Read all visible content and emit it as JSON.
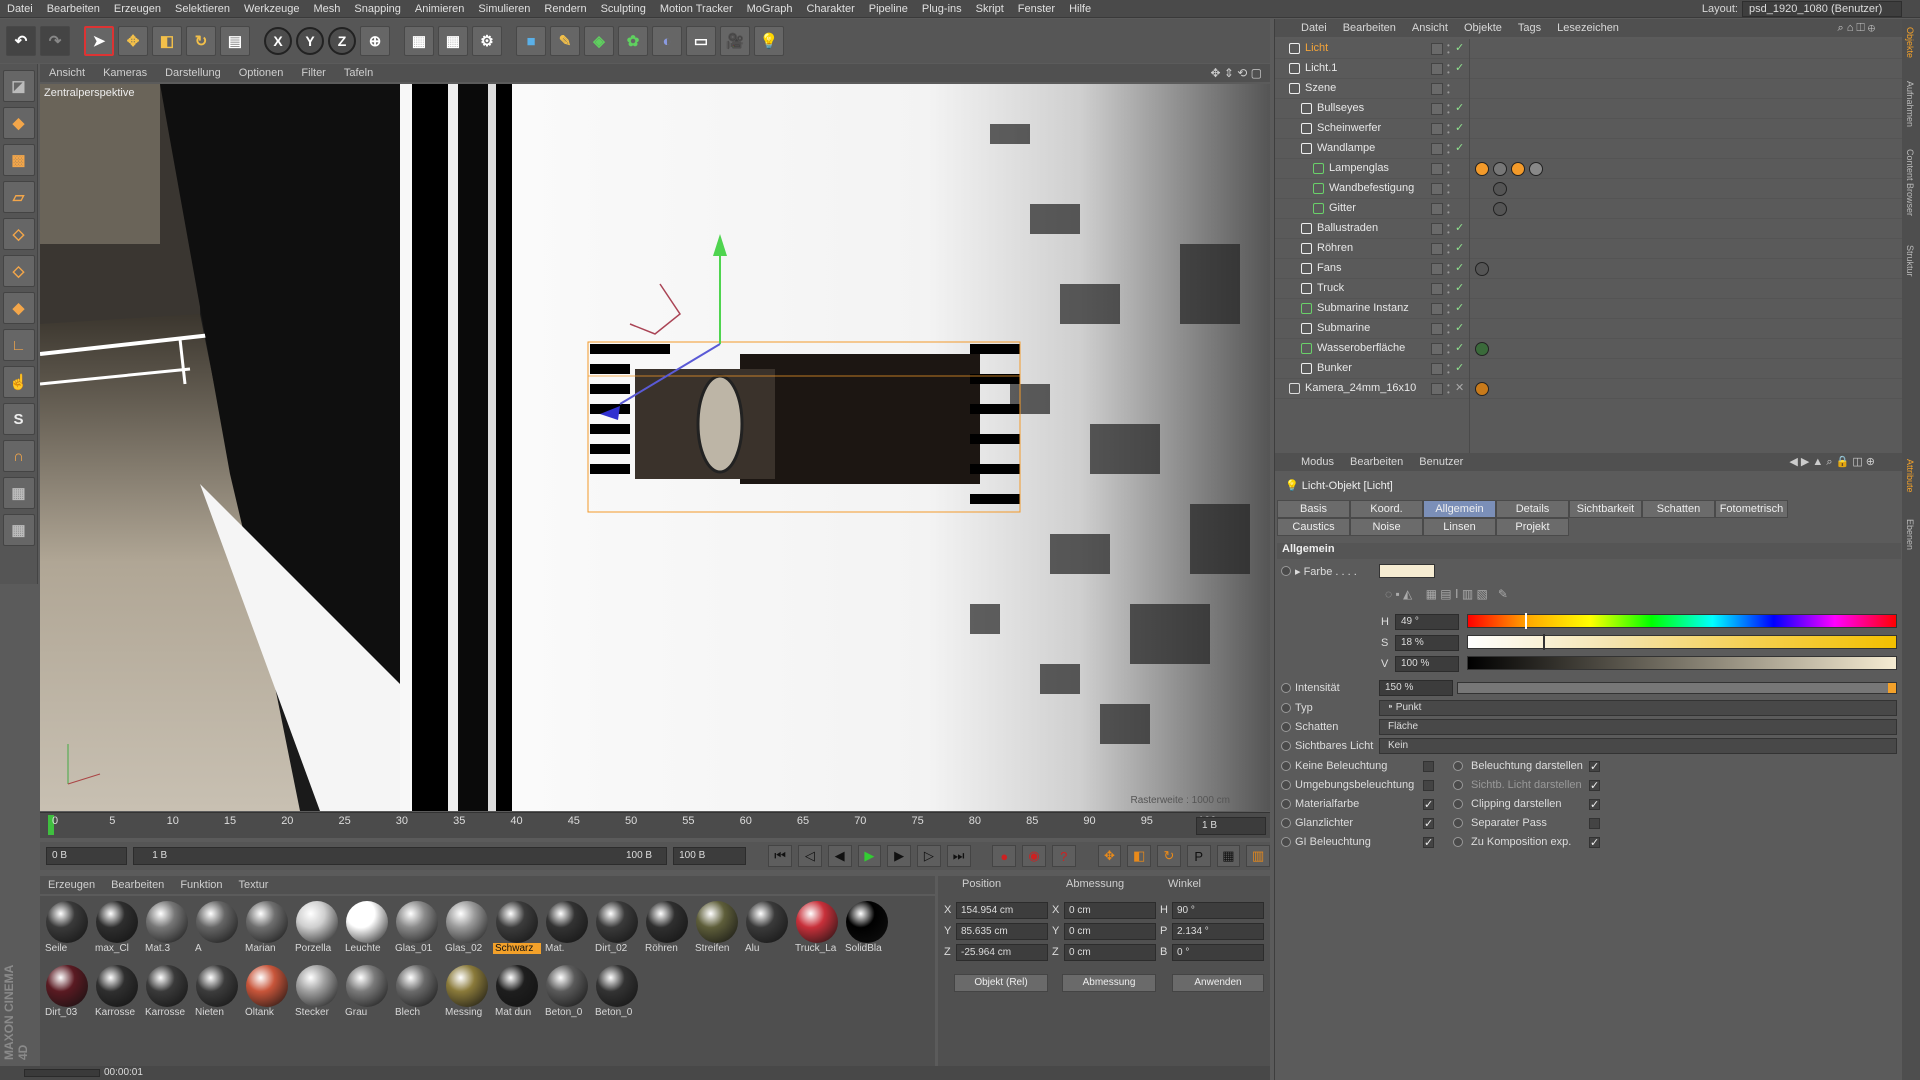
{
  "menu": [
    "Datei",
    "Bearbeiten",
    "Erzeugen",
    "Selektieren",
    "Werkzeuge",
    "Mesh",
    "Snapping",
    "Animieren",
    "Simulieren",
    "Rendern",
    "Sculpting",
    "Motion Tracker",
    "MoGraph",
    "Charakter",
    "Pipeline",
    "Plug-ins",
    "Skript",
    "Fenster",
    "Hilfe"
  ],
  "layout": {
    "label": "Layout:",
    "value": "psd_1920_1080 (Benutzer)"
  },
  "toolbar": {
    "x": "X",
    "y": "Y",
    "z": "Z"
  },
  "viewport": {
    "menu": [
      "Ansicht",
      "Kameras",
      "Darstellung",
      "Optionen",
      "Filter",
      "Tafeln"
    ],
    "label": "Zentralperspektive",
    "grid_label": "Rasterweite : 1000 cm"
  },
  "timeline": {
    "ticks": [
      "0",
      "5",
      "10",
      "15",
      "20",
      "25",
      "30",
      "35",
      "40",
      "45",
      "50",
      "55",
      "60",
      "65",
      "70",
      "75",
      "80",
      "85",
      "90",
      "95",
      "100"
    ],
    "frame_end_label": "1 B",
    "current": "0 B",
    "range_start": "1 B",
    "range_end": "100 B",
    "max": "100 B"
  },
  "materials": {
    "menu": [
      "Erzeugen",
      "Bearbeiten",
      "Funktion",
      "Textur"
    ],
    "items": [
      {
        "name": "Seile",
        "color": "#3a3a3a"
      },
      {
        "name": "max_Cl",
        "color": "#2e2e2e"
      },
      {
        "name": "Mat.3",
        "color": "#777"
      },
      {
        "name": "A",
        "color": "#666"
      },
      {
        "name": "Marian",
        "color": "#6f6f6f"
      },
      {
        "name": "Porzella",
        "color": "#cfcfcf"
      },
      {
        "name": "Leuchte",
        "color": "#ffffff"
      },
      {
        "name": "Glas_01",
        "color": "#8a8a8a"
      },
      {
        "name": "Glas_02",
        "color": "#9a9a9a"
      },
      {
        "name": "Schwarz",
        "color": "#3c3c3c"
      },
      {
        "name": "Mat.",
        "color": "#333"
      },
      {
        "name": "Dirt_02",
        "color": "#3a3a3a"
      },
      {
        "name": "Röhren",
        "color": "#2f2f2f"
      },
      {
        "name": "Streifen",
        "color": "#5e5e3a"
      },
      {
        "name": "Alu",
        "color": "#3a3a3a"
      },
      {
        "name": "Truck_La",
        "color": "#c8303a"
      },
      {
        "name": "SolidBla",
        "color": "#000000"
      },
      {
        "name": "Dirt_03",
        "color": "#5a1a22"
      },
      {
        "name": "Karrosse",
        "color": "#2f2f2f"
      },
      {
        "name": "Karrosse",
        "color": "#3a3a3a"
      },
      {
        "name": "Nieten",
        "color": "#3c3c3c"
      },
      {
        "name": "Öltank",
        "color": "#c8553a"
      },
      {
        "name": "Stecker",
        "color": "#a0a0a0"
      },
      {
        "name": "Grau",
        "color": "#7a7a7a"
      },
      {
        "name": "Blech",
        "color": "#6a6a6a"
      },
      {
        "name": "Messing",
        "color": "#8a7a3a"
      },
      {
        "name": "Mat dun",
        "color": "#1e1e1e"
      },
      {
        "name": "Beton_0",
        "color": "#5a5a5a"
      },
      {
        "name": "Beton_0",
        "color": "#333"
      }
    ],
    "highlight_index": 9
  },
  "coords": {
    "headers": [
      "Position",
      "Abmessung",
      "Winkel"
    ],
    "rows": [
      {
        "axis": "X",
        "pos": "154.954 cm",
        "size_axis": "X",
        "size": "0 cm",
        "ang_axis": "H",
        "ang": "90 °"
      },
      {
        "axis": "Y",
        "pos": "85.635 cm",
        "size_axis": "Y",
        "size": "0 cm",
        "ang_axis": "P",
        "ang": "2.134 °"
      },
      {
        "axis": "Z",
        "pos": "-25.964 cm",
        "size_axis": "Z",
        "size": "0 cm",
        "ang_axis": "B",
        "ang": "0 °"
      }
    ],
    "mode": "Objekt (Rel)",
    "size_mode": "Abmessung",
    "apply": "Anwenden"
  },
  "status": {
    "time": "00:00:01"
  },
  "objects": {
    "menu": [
      "Datei",
      "Bearbeiten",
      "Ansicht",
      "Objekte",
      "Tags",
      "Lesezeichen"
    ],
    "rows": [
      {
        "name": "Licht",
        "indent": 0,
        "active": true,
        "icon": "light-icon"
      },
      {
        "name": "Licht.1",
        "indent": 0,
        "active": false,
        "icon": "light-icon"
      },
      {
        "name": "Szene",
        "indent": 0,
        "active": false,
        "icon": "null-icon"
      },
      {
        "name": "Bullseyes",
        "indent": 1,
        "active": false,
        "icon": "null-icon"
      },
      {
        "name": "Scheinwerfer",
        "indent": 1,
        "active": false,
        "icon": "null-icon"
      },
      {
        "name": "Wandlampe",
        "indent": 1,
        "active": false,
        "icon": "null-icon"
      },
      {
        "name": "Lampenglas",
        "indent": 2,
        "active": false,
        "icon": "lathe-icon"
      },
      {
        "name": "Wandbefestigung",
        "indent": 2,
        "active": false,
        "icon": "symmetry-icon"
      },
      {
        "name": "Gitter",
        "indent": 2,
        "active": false,
        "icon": "sweep-icon"
      },
      {
        "name": "Ballustraden",
        "indent": 1,
        "active": false,
        "icon": "null-icon"
      },
      {
        "name": "Röhren",
        "indent": 1,
        "active": false,
        "icon": "null-icon"
      },
      {
        "name": "Fans",
        "indent": 1,
        "active": false,
        "icon": "null-icon"
      },
      {
        "name": "Truck",
        "indent": 1,
        "active": false,
        "icon": "null-icon"
      },
      {
        "name": "Submarine Instanz",
        "indent": 1,
        "active": false,
        "icon": "instance-icon"
      },
      {
        "name": "Submarine",
        "indent": 1,
        "active": false,
        "icon": "null-icon"
      },
      {
        "name": "Wasseroberfläche",
        "indent": 1,
        "active": false,
        "icon": "plane-icon"
      },
      {
        "name": "Bunker",
        "indent": 1,
        "active": false,
        "icon": "null-icon"
      },
      {
        "name": "Kamera_24mm_16x10",
        "indent": 0,
        "active": false,
        "icon": "camera-icon"
      }
    ]
  },
  "attributes": {
    "menu": [
      "Modus",
      "Bearbeiten",
      "Benutzer"
    ],
    "title": "Licht-Objekt [Licht]",
    "tabs": [
      "Basis",
      "Koord.",
      "Allgemein",
      "Details",
      "Sichtbarkeit",
      "Schatten",
      "Fotometrisch",
      "Caustics",
      "Noise",
      "Linsen",
      "Projekt"
    ],
    "active_tab": "Allgemein",
    "section": "Allgemein",
    "color_label": "Farbe",
    "color_value": "#f6ecd2",
    "h": {
      "label": "H",
      "value": "49 °"
    },
    "s": {
      "label": "S",
      "value": "18 %"
    },
    "v": {
      "label": "V",
      "value": "100 %"
    },
    "intensity": {
      "label": "Intensität",
      "value": "150 %"
    },
    "type": {
      "label": "Typ",
      "value": "Punkt"
    },
    "shadow": {
      "label": "Schatten",
      "value": "Fläche"
    },
    "visible_light": {
      "label": "Sichtbares Licht",
      "value": "Kein"
    },
    "checks_left": [
      {
        "label": "Keine Beleuchtung",
        "checked": false
      },
      {
        "label": "Umgebungsbeleuchtung",
        "checked": false
      },
      {
        "label": "Materialfarbe",
        "checked": true
      },
      {
        "label": "Glanzlichter",
        "checked": true
      },
      {
        "label": "GI Beleuchtung",
        "checked": true
      }
    ],
    "checks_right": [
      {
        "label": "Beleuchtung darstellen",
        "checked": true
      },
      {
        "label": "Sichtb. Licht darstellen",
        "checked": true
      },
      {
        "label": "Clipping darstellen",
        "checked": true
      },
      {
        "label": "Separater Pass",
        "checked": false
      },
      {
        "label": "Zu Komposition exp.",
        "checked": true
      }
    ]
  },
  "side_tabs": [
    "Objekte",
    "Aufnahmen",
    "Content Browser",
    "Struktur",
    "Attribute",
    "Ebenen"
  ],
  "brand": "MAXON CINEMA 4D"
}
